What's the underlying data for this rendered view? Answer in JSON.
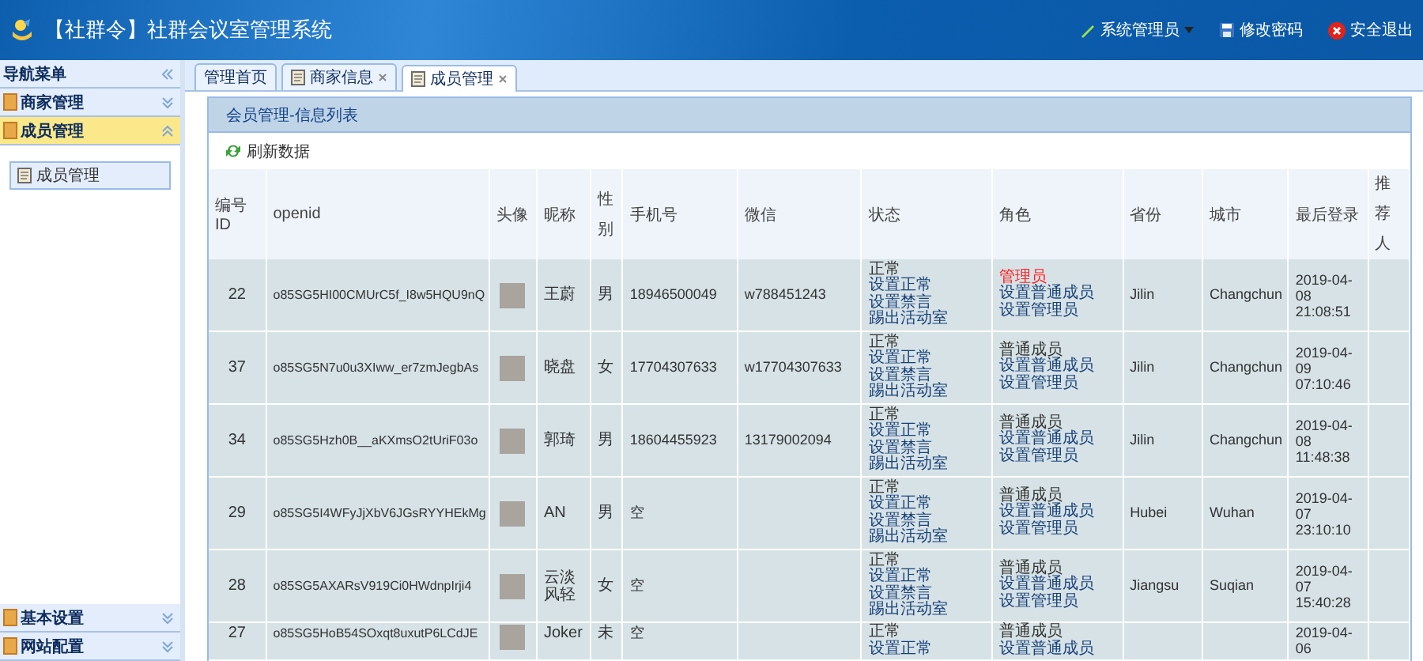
{
  "header": {
    "title": "【社群令】社群会议室管理系统",
    "actions": [
      {
        "kind": "user",
        "label": "系统管理员"
      },
      {
        "kind": "password",
        "label": "修改密码"
      },
      {
        "kind": "logout",
        "label": "安全退出"
      }
    ]
  },
  "sidebar": {
    "title": "导航菜单",
    "groups": [
      {
        "label": "商家管理",
        "expanded": false
      },
      {
        "label": "成员管理",
        "expanded": true,
        "items": [
          {
            "label": "成员管理",
            "selected": true
          }
        ]
      }
    ],
    "bottom_groups": [
      {
        "label": "基本设置",
        "expanded": false
      },
      {
        "label": "网站配置",
        "expanded": false
      }
    ]
  },
  "tabs": [
    {
      "label": "管理首页",
      "closable": false,
      "selected": false
    },
    {
      "label": "商家信息",
      "closable": true,
      "selected": false
    },
    {
      "label": "成员管理",
      "closable": true,
      "selected": true
    }
  ],
  "panel": {
    "title": "会员管理-信息列表",
    "toolbar": [
      "刷新数据"
    ]
  },
  "table": {
    "columns": [
      "编号ID",
      "openid",
      "头像",
      "昵称",
      "性别",
      "手机号",
      "微信",
      "状态",
      "角色",
      "省份",
      "城市",
      "最后登录",
      "推荐人"
    ],
    "rows": [
      {
        "id": "22",
        "openid": "o85SG5HI00CMUrC5f_I8w5HQU9nQ",
        "nickname": "王蔚",
        "gender": "男",
        "phone": "18946500049",
        "wechat": "w788451243",
        "status": "正常",
        "status_links": [
          "设置正常",
          "设置禁言",
          "踢出活动室"
        ],
        "role": "管理员",
        "role_highlight": true,
        "role_links": [
          "设置普通成员",
          "设置管理员"
        ],
        "province": "Jilin",
        "city": "Changchun",
        "last_login": "2019-04-08 21:08:51"
      },
      {
        "id": "37",
        "openid": "o85SG5N7u0u3XIww_er7zmJegbAs",
        "nickname": "晓盘",
        "gender": "女",
        "phone": "17704307633",
        "wechat": "w17704307633",
        "status": "正常",
        "status_links": [
          "设置正常",
          "设置禁言",
          "踢出活动室"
        ],
        "role": "普通成员",
        "role_highlight": false,
        "role_links": [
          "设置普通成员",
          "设置管理员"
        ],
        "province": "Jilin",
        "city": "Changchun",
        "last_login": "2019-04-09 07:10:46"
      },
      {
        "id": "34",
        "openid": "o85SG5Hzh0B__aKXmsO2tUriF03o",
        "nickname": "郭琦",
        "gender": "男",
        "phone": "18604455923",
        "wechat": "13179002094",
        "status": "正常",
        "status_links": [
          "设置正常",
          "设置禁言",
          "踢出活动室"
        ],
        "role": "普通成员",
        "role_highlight": false,
        "role_links": [
          "设置普通成员",
          "设置管理员"
        ],
        "province": "Jilin",
        "city": "Changchun",
        "last_login": "2019-04-08 11:48:38"
      },
      {
        "id": "29",
        "openid": "o85SG5I4WFyJjXbV6JGsRYYHEkMg",
        "nickname": "AN",
        "gender": "男",
        "phone": "空",
        "status": "正常",
        "status_links": [
          "设置正常",
          "设置禁言",
          "踢出活动室"
        ],
        "role": "普通成员",
        "role_highlight": false,
        "role_links": [
          "设置普通成员",
          "设置管理员"
        ],
        "province": "Hubei",
        "city": "Wuhan",
        "last_login": "2019-04-07 23:10:10"
      },
      {
        "id": "28",
        "openid": "o85SG5AXARsV919Ci0HWdnpIrji4",
        "nickname": "云淡风轻",
        "gender": "女",
        "phone": "空",
        "status": "正常",
        "status_links": [
          "设置正常",
          "设置禁言",
          "踢出活动室"
        ],
        "role": "普通成员",
        "role_highlight": false,
        "role_links": [
          "设置普通成员",
          "设置管理员"
        ],
        "province": "Jiangsu",
        "city": "Suqian",
        "last_login": "2019-04-07 15:40:28"
      },
      {
        "id": "27",
        "openid": "o85SG5HoB54SOxqt8uxutP6LCdJE",
        "nickname": "Joker",
        "gender": "未",
        "phone": "空",
        "status": "正常",
        "status_links": [
          "设置正常"
        ],
        "role": "普通成员",
        "role_highlight": false,
        "role_links": [
          "设置普通成员"
        ],
        "last_login": "2019-04-06"
      }
    ]
  }
}
